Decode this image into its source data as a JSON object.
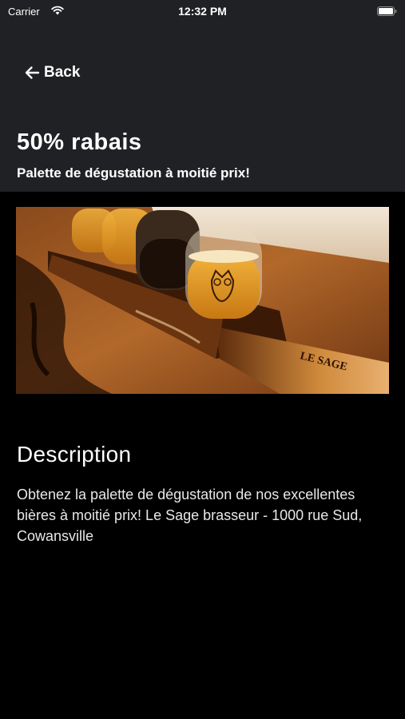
{
  "status_bar": {
    "carrier": "Carrier",
    "time": "12:32 PM"
  },
  "nav": {
    "back_label": "Back"
  },
  "offer": {
    "title": "50% rabais",
    "subtitle": "Palette de dégustation à moitié prix!"
  },
  "description": {
    "heading": "Description",
    "text": "Obtenez la palette de dégustation de nos excellentes bières à moitié prix! Le Sage brasseur - 1000 rue Sud, Cowansville"
  },
  "photo": {
    "board_text": "LE SAGE"
  },
  "colors": {
    "header_bg": "#202124",
    "page_bg": "#000000",
    "text": "#ffffff"
  }
}
